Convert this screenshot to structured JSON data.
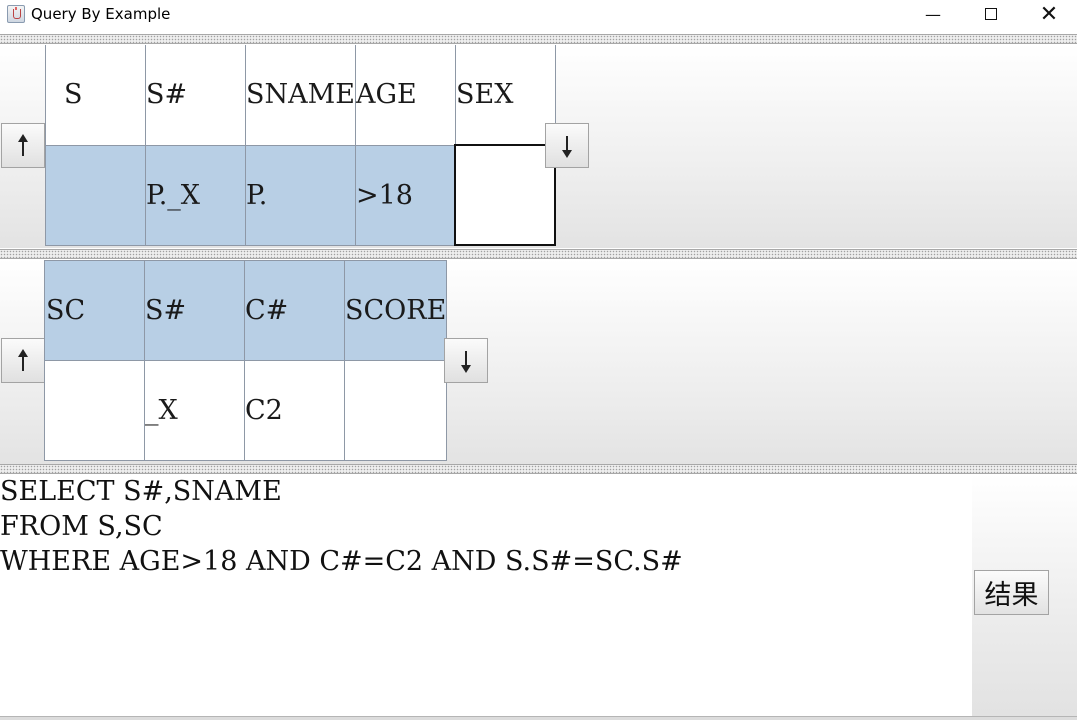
{
  "window": {
    "title": "Query By Example"
  },
  "table_s": {
    "columns": [
      "S",
      "S#",
      "SNAME",
      "AGE",
      "SEX"
    ],
    "row": [
      "",
      "P._X",
      "P.",
      ">18",
      ""
    ]
  },
  "table_sc": {
    "columns": [
      "SC",
      "S#",
      "C#",
      "SCORE"
    ],
    "row": [
      "",
      "_X",
      "C2",
      ""
    ]
  },
  "sql": {
    "lines": [
      "SELECT S#,SNAME",
      "FROM S,SC",
      "WHERE AGE>18 AND C#=C2 AND S.S#=SC.S#"
    ]
  },
  "buttons": {
    "result_label": "结果"
  },
  "colors": {
    "selected_row": "#b8cfe5",
    "grid_border": "#8e98a6"
  },
  "icons": [
    "java-app-icon",
    "minimize-icon",
    "maximize-icon",
    "close-icon",
    "arrow-up-icon",
    "arrow-down-icon"
  ]
}
